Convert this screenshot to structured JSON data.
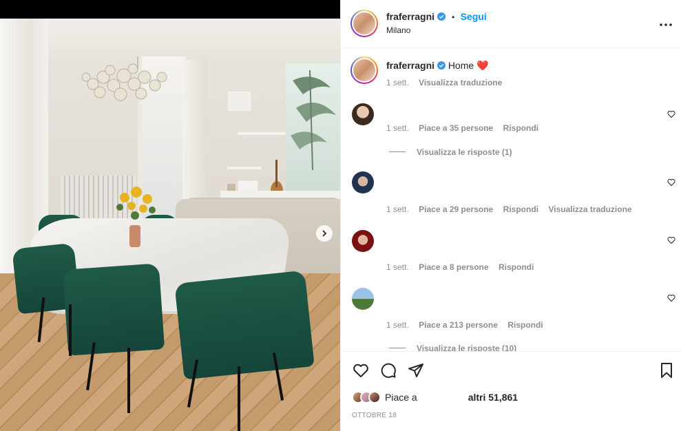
{
  "header": {
    "username": "fraferragni",
    "separator": "•",
    "follow_label": "Segui",
    "location": "Milano",
    "more_label": "•••"
  },
  "caption": {
    "username": "fraferragni",
    "text": "Home",
    "emoji": "❤️",
    "time": "1 sett.",
    "translate_label": "Visualizza traduzione"
  },
  "comments": [
    {
      "time": "1 sett.",
      "likes": "Piace a 35 persone",
      "reply_label": "Rispondi",
      "view_replies": "Visualizza le risposte (1)"
    },
    {
      "time": "1 sett.",
      "likes": "Piace a 29 persone",
      "reply_label": "Rispondi",
      "translate_label": "Visualizza traduzione"
    },
    {
      "time": "1 sett.",
      "likes": "Piace a 8 persone",
      "reply_label": "Rispondi"
    },
    {
      "time": "1 sett.",
      "likes": "Piace a 213 persone",
      "reply_label": "Rispondi",
      "view_replies": "Visualizza le risposte (10)"
    }
  ],
  "likes": {
    "prefix": "Piace a",
    "suffix": "altri 51,861"
  },
  "date": "OTTOBRE 18",
  "colors": {
    "accent": "#0095f6",
    "text": "#262626",
    "muted": "#8e8e8e",
    "verified": "#3897f0",
    "heart": "#ed4956"
  }
}
